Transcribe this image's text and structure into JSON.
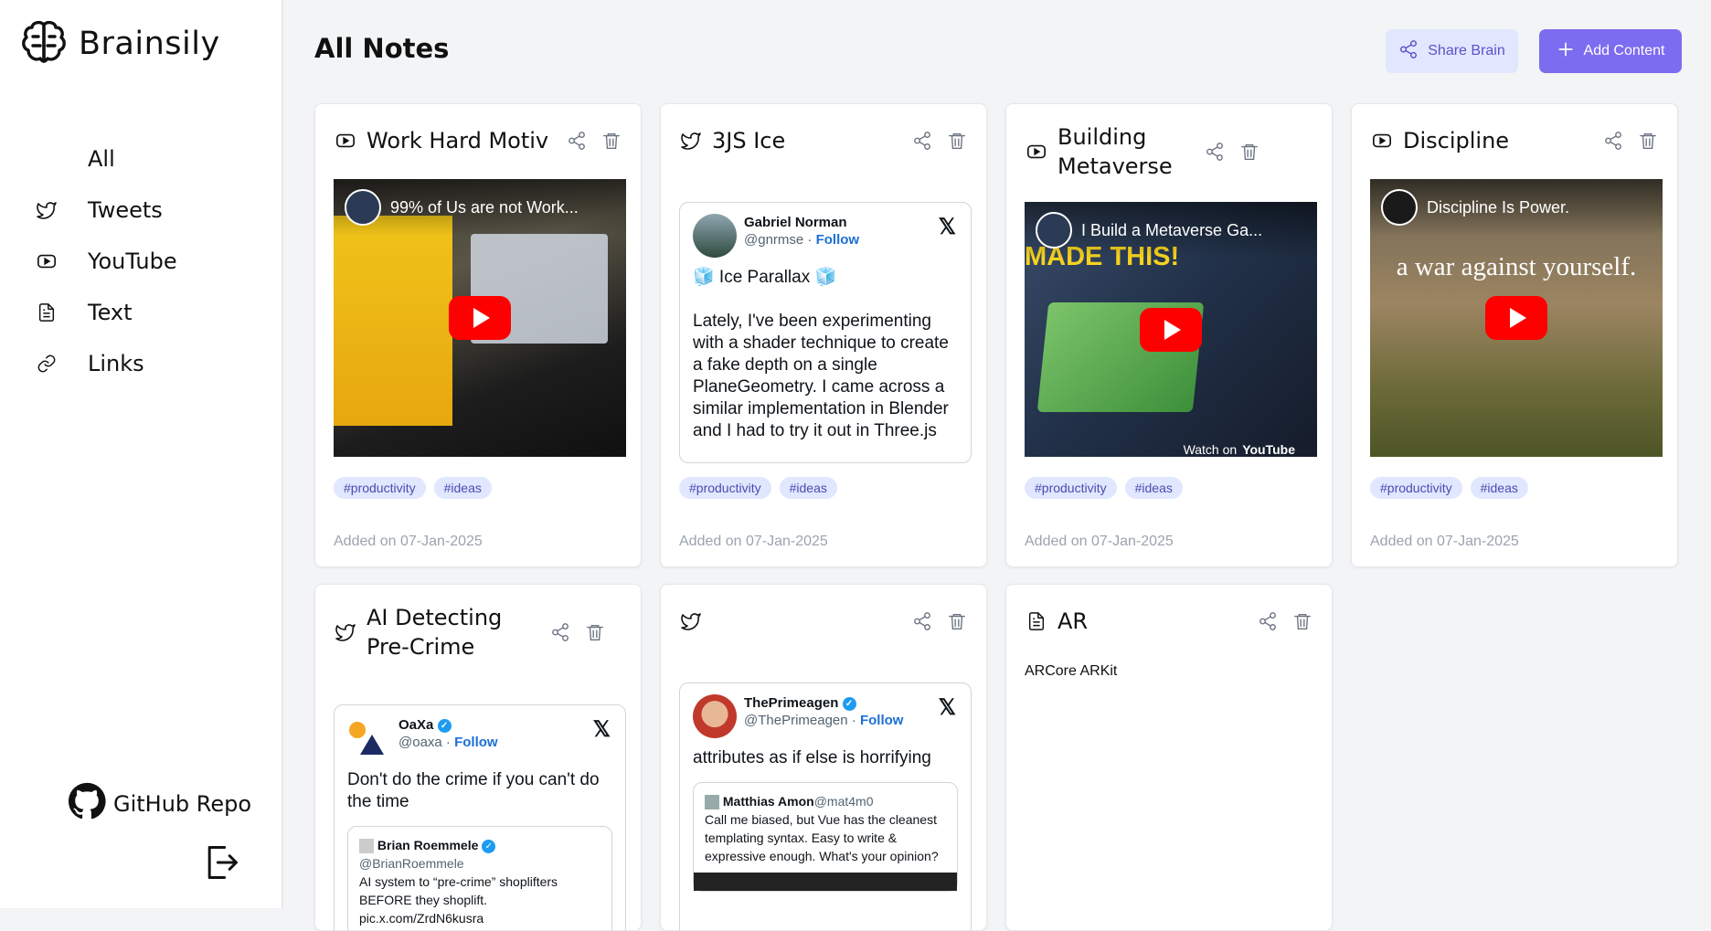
{
  "app": {
    "name": "Brainsily"
  },
  "sidebar": {
    "items": [
      {
        "label": "All",
        "icon": "none"
      },
      {
        "label": "Tweets",
        "icon": "twitter-icon"
      },
      {
        "label": "YouTube",
        "icon": "youtube-icon"
      },
      {
        "label": "Text",
        "icon": "document-icon"
      },
      {
        "label": "Links",
        "icon": "link-icon"
      }
    ],
    "github_label": "GitHub Repo"
  },
  "header": {
    "title": "All Notes",
    "share_label": "Share Brain",
    "add_label": "Add Content"
  },
  "colors": {
    "accent": "#7c6cf0",
    "accent_light": "#e0e7ff",
    "youtube_red": "#ff0000"
  },
  "cards": [
    {
      "type": "youtube",
      "title": "Work Hard Motiv",
      "video_title": "99% of Us are not Work...",
      "tags": [
        "#productivity",
        "#ideas"
      ],
      "added": "Added on 07-Jan-2025"
    },
    {
      "type": "tweet",
      "title": "3JS Ice",
      "tweet": {
        "name": "Gabriel Norman",
        "handle": "@gnrmse",
        "follow": "Follow",
        "line1": "🧊 Ice Parallax 🧊",
        "body": "Lately, I've been experimenting with a shader technique to create a fake depth on a single PlaneGeometry. I came across a similar implementation in Blender and I had to try it out in Three.js"
      },
      "tags": [
        "#productivity",
        "#ideas"
      ],
      "added": "Added on 07-Jan-2025"
    },
    {
      "type": "youtube",
      "title": "Building Metaverse",
      "video_title": "I Build a Metaverse Ga...",
      "video_overlay": "MADE THIS!",
      "watch_on": "Watch on",
      "watch_brand": "YouTube",
      "tags": [
        "#productivity",
        "#ideas"
      ],
      "added": "Added on 07-Jan-2025"
    },
    {
      "type": "youtube",
      "title": "Discipline",
      "video_title": "Discipline Is Power.",
      "video_overlay": "a war against yourself.",
      "tags": [
        "#productivity",
        "#ideas"
      ],
      "added": "Added on 07-Jan-2025"
    },
    {
      "type": "tweet",
      "title": "AI Detecting Pre-Crime",
      "tweet": {
        "name": "OaXa",
        "handle": "@oaxa",
        "follow": "Follow",
        "body": "Don't do the crime if you can't do the time",
        "quote_name": "Brian Roemmele",
        "quote_handle": "@BrianRoemmele",
        "quote_body": "AI system to “pre-crime” shoplifters BEFORE they shoplift. pic.x.com/ZrdN6kusra"
      }
    },
    {
      "type": "tweet",
      "title": "",
      "tweet": {
        "name": "ThePrimeagen",
        "handle": "@ThePrimeagen",
        "follow": "Follow",
        "body": "attributes as if else is horrifying",
        "quote_name": "Matthias Amon",
        "quote_handle": "@mat4m0",
        "quote_body": "Call me biased, but Vue has the cleanest templating syntax. Easy to write & expressive enough. What's your opinion?"
      }
    },
    {
      "type": "text",
      "title": "AR",
      "content": "ARCore ARKit"
    }
  ]
}
